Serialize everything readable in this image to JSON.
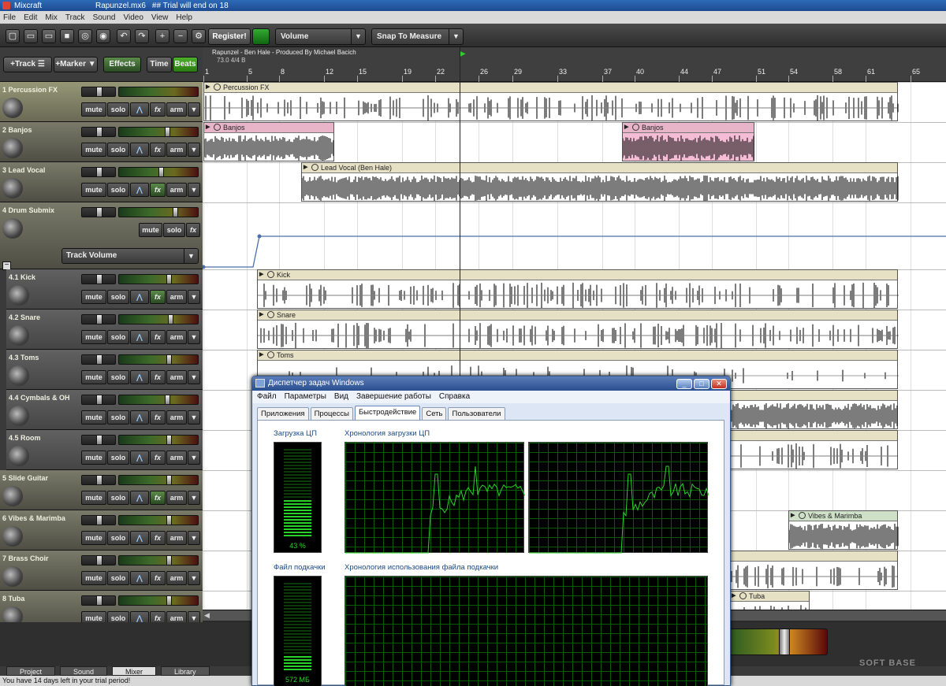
{
  "window": {
    "app": "Mixcraft",
    "file": "Rapunzel.mx6",
    "notice": "## Trial will end on 18"
  },
  "menu": [
    "File",
    "Edit",
    "Mix",
    "Track",
    "Sound",
    "Video",
    "View",
    "Help"
  ],
  "toolbar": {
    "register_label": "Register!",
    "volume_dropdown": "Volume",
    "snap_dropdown": "Snap To Measure"
  },
  "controls": {
    "add_track": "+Track",
    "add_marker": "+Marker",
    "effects": "Effects",
    "time": "Time",
    "beats": "Beats"
  },
  "song": {
    "title": "Rapunzel - Ben Hale - Produced By Michael Bacich",
    "info": "73.0 4/4 B"
  },
  "ruler": [
    "1",
    "5",
    "8",
    "12",
    "15",
    "19",
    "22",
    "26",
    "29",
    "33",
    "37",
    "40",
    "44",
    "47",
    "51",
    "54",
    "58",
    "61",
    "65"
  ],
  "track_buttons": {
    "mute": "mute",
    "solo": "solo",
    "fx": "fx",
    "arm": "arm"
  },
  "tracks": [
    {
      "name": "1 Percussion FX"
    },
    {
      "name": "2 Banjos"
    },
    {
      "name": "3 Lead Vocal"
    },
    {
      "name": "4 Drum Submix",
      "automation": "Track Volume"
    },
    {
      "name": "4.1 Kick"
    },
    {
      "name": "4.2 Snare"
    },
    {
      "name": "4.3 Toms"
    },
    {
      "name": "4.4 Cymbals & OH"
    },
    {
      "name": "4.5 Room"
    },
    {
      "name": "5 Slide Guitar"
    },
    {
      "name": "6 Vibes & Marimba"
    },
    {
      "name": "7 Brass Choir"
    },
    {
      "name": "8 Tuba"
    }
  ],
  "clips": {
    "percussion": "Percussion FX",
    "banjos_1": "Banjos",
    "banjos_2": "Banjos",
    "vocal": "Lead Vocal (Ben Hale)",
    "kick": "Kick",
    "snare": "Snare",
    "toms": "Toms",
    "vibes": "Vibes & Marimba",
    "tuba": "Tuba"
  },
  "bottom_tabs": [
    "Project",
    "Sound",
    "Mixer",
    "Library"
  ],
  "status": "You have 14 days left in your trial period!",
  "watermark": "SOFT BASE",
  "taskmanager": {
    "title": "Диспетчер задач Windows",
    "menu": [
      "Файл",
      "Параметры",
      "Вид",
      "Завершение работы",
      "Справка"
    ],
    "tabs": [
      "Приложения",
      "Процессы",
      "Быстродействие",
      "Сеть",
      "Пользователи"
    ],
    "cpu_label": "Загрузка ЦП",
    "cpu_history_label": "Хронология загрузки ЦП",
    "cpu_value": "43 %",
    "cpu_fraction": 0.43,
    "pf_label": "Файл подкачки",
    "pf_history_label": "Хронология использования файла подкачки",
    "pf_value": "572 МБ",
    "pf_fraction": 0.12
  },
  "colors": {
    "accent_green": "#2ad12a",
    "clip_header": "#e6e1c5",
    "banjo_clip": "#e8b4c8"
  }
}
